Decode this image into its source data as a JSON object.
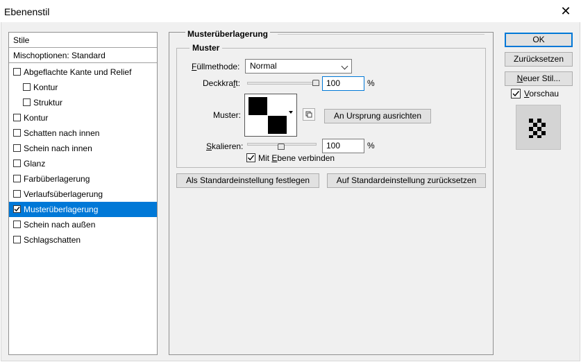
{
  "window": {
    "title": "Ebenenstil",
    "close_glyph": "✕"
  },
  "left": {
    "items": [
      {
        "label": "Stile",
        "checkbox": false
      },
      {
        "label": "Mischoptionen: Standard",
        "checkbox": false
      },
      {
        "label": "Abgeflachte Kante und Relief",
        "checkbox": true,
        "checked": false
      },
      {
        "label": "Kontur",
        "checkbox": true,
        "checked": false
      },
      {
        "label": "Struktur",
        "checkbox": true,
        "checked": false
      },
      {
        "label": "Kontur",
        "checkbox": true,
        "checked": false
      },
      {
        "label": "Schatten nach innen",
        "checkbox": true,
        "checked": false
      },
      {
        "label": "Schein nach innen",
        "checkbox": true,
        "checked": false
      },
      {
        "label": "Glanz",
        "checkbox": true,
        "checked": false
      },
      {
        "label": "Farbüberlagerung",
        "checkbox": true,
        "checked": false
      },
      {
        "label": "Verlaufsüberlagerung",
        "checkbox": true,
        "checked": false
      },
      {
        "label": "Musterüberlagerung",
        "checkbox": true,
        "checked": true,
        "selected": true
      },
      {
        "label": "Schein nach außen",
        "checkbox": true,
        "checked": false
      },
      {
        "label": "Schlagschatten",
        "checkbox": true,
        "checked": false
      }
    ]
  },
  "main": {
    "section_title": "Musterüberlagerung",
    "group_title": "Muster",
    "blend_label": "Füllmethode:",
    "blend_value": "Normal",
    "opacity_label": "Deckkraft:",
    "opacity_value": "100",
    "opacity_slider": 1.0,
    "percent": "%",
    "pattern_label": "Muster:",
    "snap_button": "An Ursprung ausrichten",
    "scale_label": "Skalieren:",
    "scale_value": "100",
    "scale_slider": 0.5,
    "link_label": "Mit Ebene verbinden",
    "link_checked": true,
    "set_default_button": "Als Standardeinstellung festlegen",
    "reset_default_button": "Auf Standardeinstellung zurücksetzen"
  },
  "side": {
    "ok": "OK",
    "reset": "Zurücksetzen",
    "new_style": "Neuer Stil...",
    "preview_label": "Vorschau",
    "preview_checked": true
  },
  "icons": {
    "close": "close-icon",
    "chevron": "chevron-down-icon",
    "check": "check-icon",
    "new_pattern": "new-preset-icon"
  }
}
